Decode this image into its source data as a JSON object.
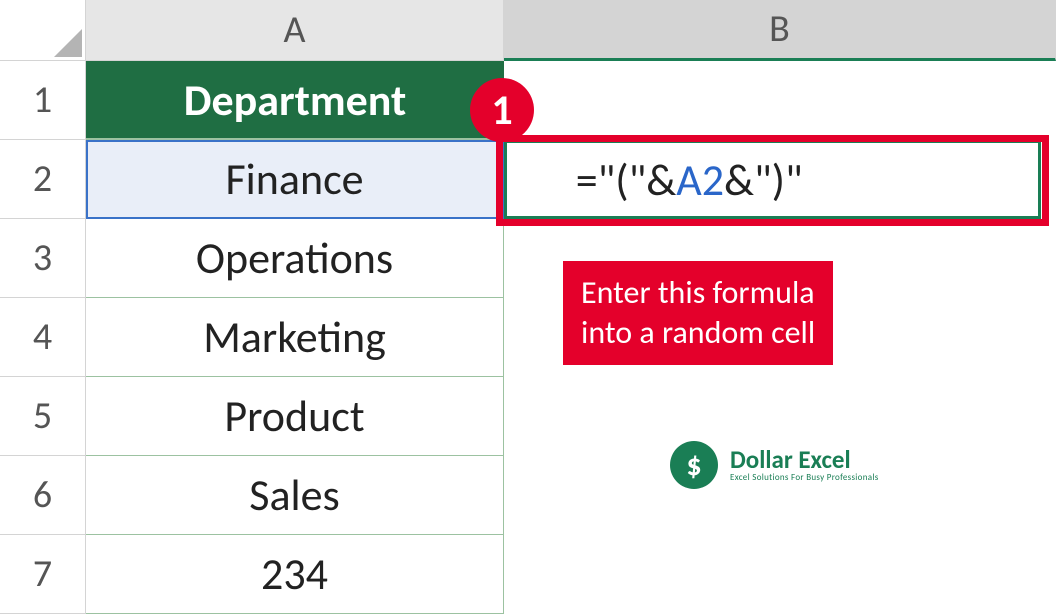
{
  "columns": {
    "A": "A",
    "B": "B"
  },
  "rows": {
    "r1": "1",
    "r2": "2",
    "r3": "3",
    "r4": "4",
    "r5": "5",
    "r6": "6",
    "r7": "7"
  },
  "cells": {
    "A1": "Department",
    "A2": "Finance",
    "A3": "Operations",
    "A4": "Marketing",
    "A5": "Product",
    "A6": "Sales",
    "A7": "234"
  },
  "formula": {
    "part1": "=\"(\"&",
    "refText": "A2",
    "part2": "&\")\""
  },
  "annotations": {
    "step_number": "1",
    "callout_line1": "Enter this formula",
    "callout_line2": "into a random cell"
  },
  "logo": {
    "symbol": "$",
    "title": "Dollar Excel",
    "subtitle": "Excel Solutions For Busy Professionals"
  },
  "colors": {
    "header_bg": "#1f6e43",
    "accent_red": "#e4002b",
    "cell_ref_blue": "#2a66c9",
    "selection_green": "#1a7e55"
  }
}
